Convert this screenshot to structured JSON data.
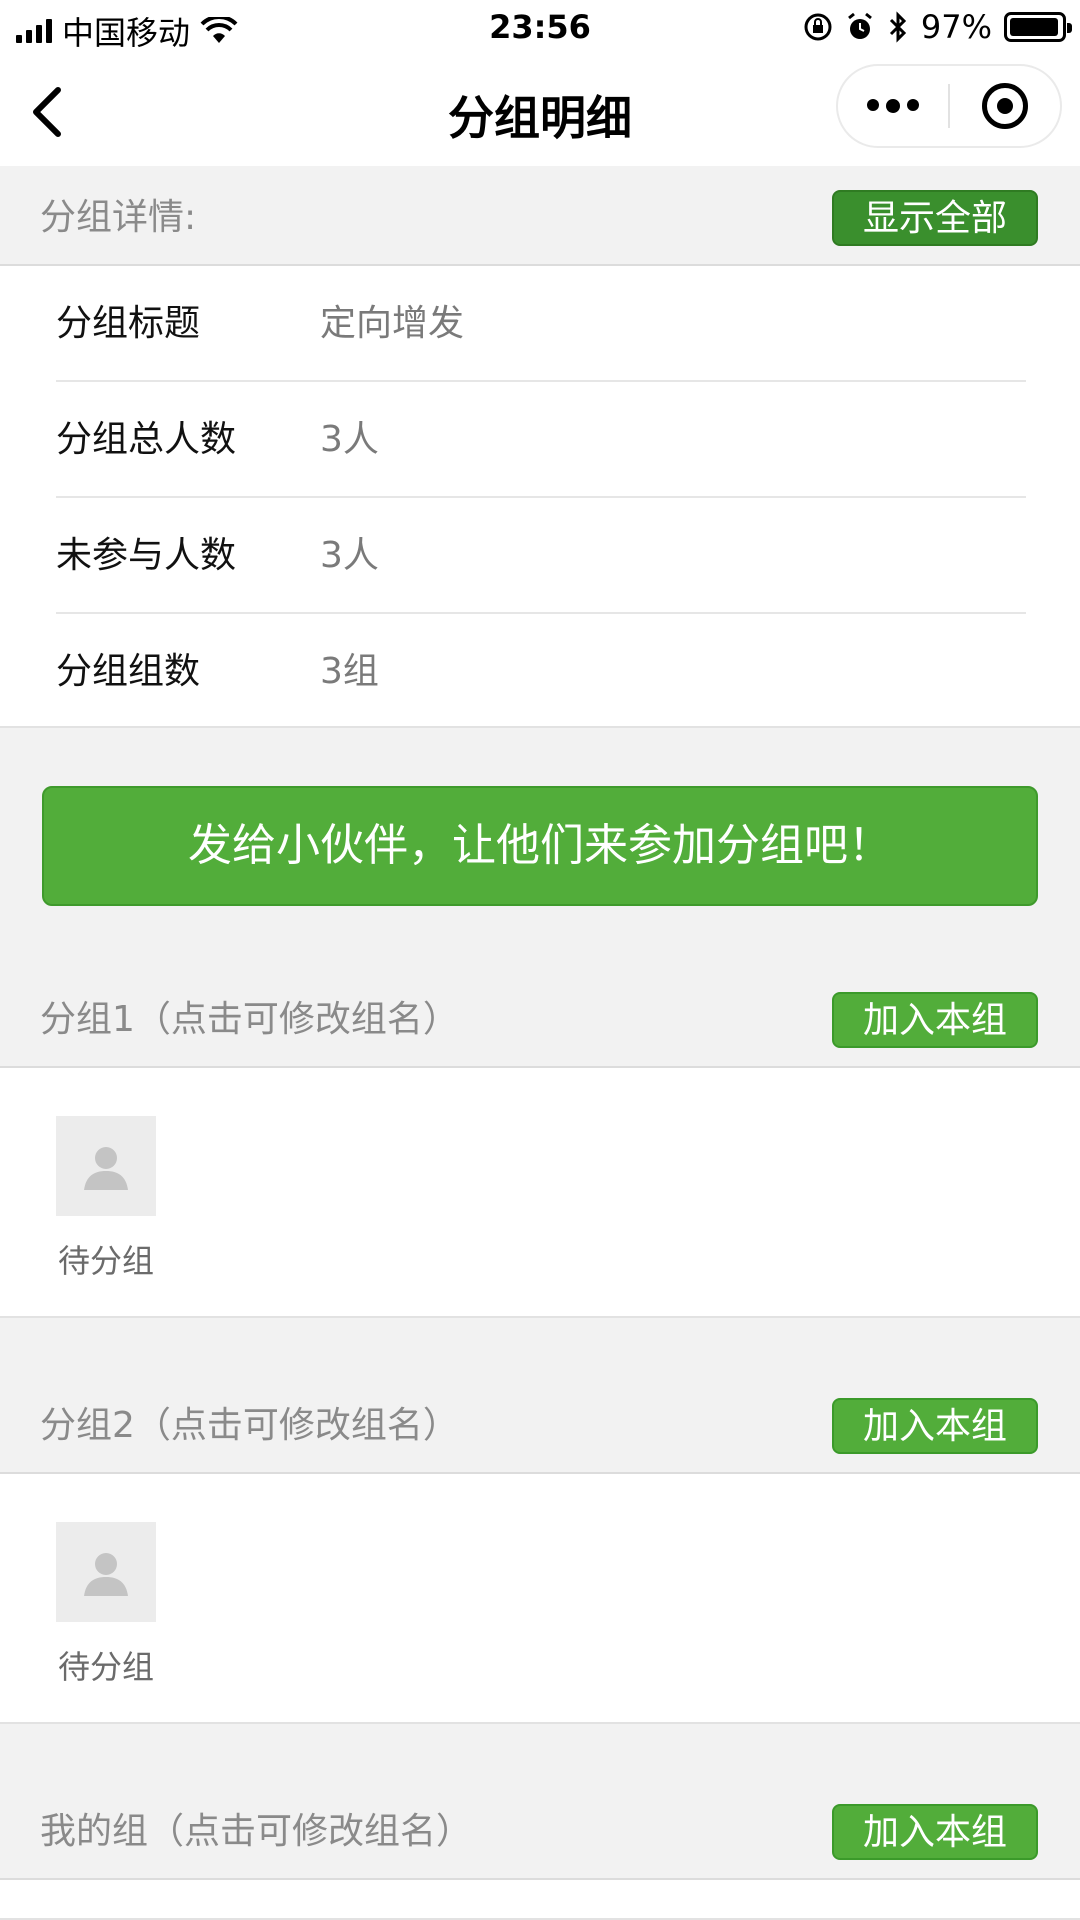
{
  "status_bar": {
    "carrier": "中国移动",
    "time": "23:56",
    "battery_percent": "97%",
    "battery_level": 0.97
  },
  "nav": {
    "title": "分组明细"
  },
  "details": {
    "header": "分组详情:",
    "show_all_label": "显示全部",
    "rows": [
      {
        "key": "分组标题",
        "value": "定向增发"
      },
      {
        "key": "分组总人数",
        "value": "3人"
      },
      {
        "key": "未参与人数",
        "value": "3人"
      },
      {
        "key": "分组组数",
        "value": "3组"
      }
    ]
  },
  "share_button": "发给小伙伴，让他们来参加分组吧！",
  "groups": [
    {
      "title": "分组1（点击可修改组名）",
      "join_label": "加入本组",
      "members": [
        {
          "name": "待分组"
        }
      ]
    },
    {
      "title": "分组2（点击可修改组名）",
      "join_label": "加入本组",
      "members": [
        {
          "name": "待分组"
        }
      ]
    },
    {
      "title": "我的组（点击可修改组名）",
      "join_label": "加入本组",
      "members": []
    }
  ],
  "icons": {
    "wifi": "wifi-icon",
    "lock_rotation": "orientation-lock-icon",
    "alarm": "alarm-icon",
    "bluetooth": "bluetooth-icon",
    "back": "back-chevron-icon",
    "more": "more-dots-icon",
    "close_target": "close-miniprogram-icon",
    "avatar": "user-avatar-icon"
  },
  "colors": {
    "green_primary": "#52ad3a",
    "green_dark": "#3a8f2d",
    "background": "#f2f2f2"
  }
}
